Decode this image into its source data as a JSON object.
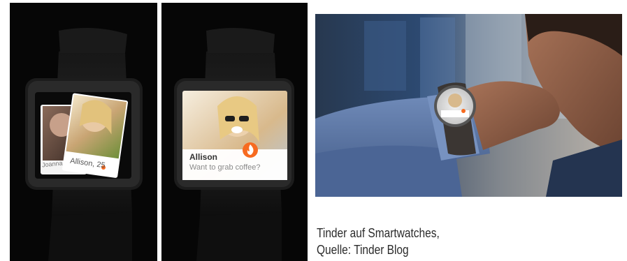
{
  "watch_left": {
    "card_back_label": "Joanna",
    "card_front_label": "Allison, 25"
  },
  "watch_middle": {
    "name": "Allison",
    "message": "Want to grab coffee?",
    "flame_color": "#f76b20"
  },
  "caption": {
    "line1": "Tinder auf Smartwatches,",
    "line2": "Quelle: Tinder Blog"
  },
  "colors": {
    "panel_bg": "#060606",
    "tinder_orange": "#f76b20",
    "shirt_blue": "#5e79a8"
  }
}
